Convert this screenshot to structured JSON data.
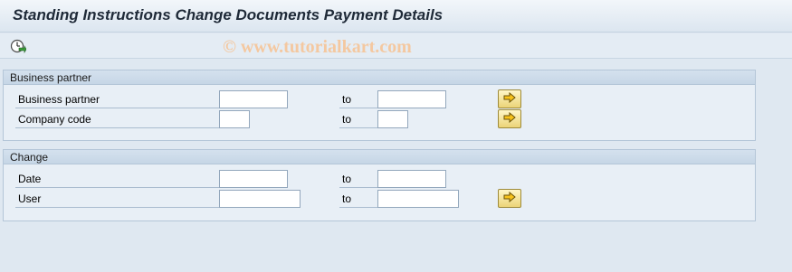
{
  "title": "Standing Instructions Change Documents Payment Details",
  "watermark": "© www.tutorialkart.com",
  "toolbar": {
    "execute_icon": "execute-clock-icon"
  },
  "groups": {
    "business_partner": {
      "title": "Business partner",
      "rows": [
        {
          "label": "Business partner",
          "to_label": "to",
          "from_value": "",
          "to_value": "",
          "more_icon": "multiple-selection-arrow-icon"
        },
        {
          "label": "Company code",
          "to_label": "to",
          "from_value": "",
          "to_value": "",
          "more_icon": "multiple-selection-arrow-icon"
        }
      ]
    },
    "change": {
      "title": "Change",
      "rows": [
        {
          "label": "Date",
          "to_label": "to",
          "from_value": "",
          "to_value": ""
        },
        {
          "label": "User",
          "to_label": "to",
          "from_value": "",
          "to_value": "",
          "more_icon": "multiple-selection-arrow-icon"
        }
      ]
    }
  },
  "colors": {
    "background": "#dfe8f1",
    "group_header": "#c6d6e6",
    "button_yellow": "#ecd478",
    "watermark": "#f4c8a0"
  }
}
